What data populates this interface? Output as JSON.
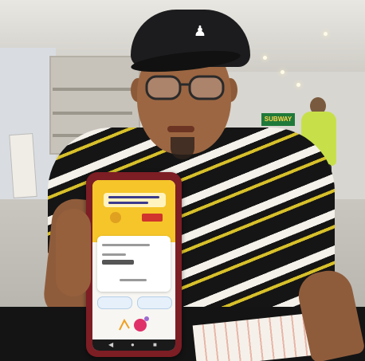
{
  "scene": {
    "colors": {
      "cap": "#1c1c1e",
      "shirt_stripe_dark": "#151515",
      "shirt_stripe_light": "#f4f1ea",
      "shirt_stripe_yellow": "#d7c02a",
      "phone_case": "#7d1d24",
      "app_header": "#f5c52a",
      "worker_vest": "#c7e04a",
      "store_sign": "#1f7a3a"
    },
    "icons": {
      "cap_logo": "jumpman-icon",
      "nav_back": "triangle-back-icon",
      "nav_home": "circle-home-icon",
      "nav_recent": "square-recent-icon"
    },
    "subway_sign_text": "SUBWAY",
    "cap_logo_glyph": "♟",
    "nav_back_glyph": "◀",
    "nav_home_glyph": "●",
    "nav_recent_glyph": "■"
  }
}
